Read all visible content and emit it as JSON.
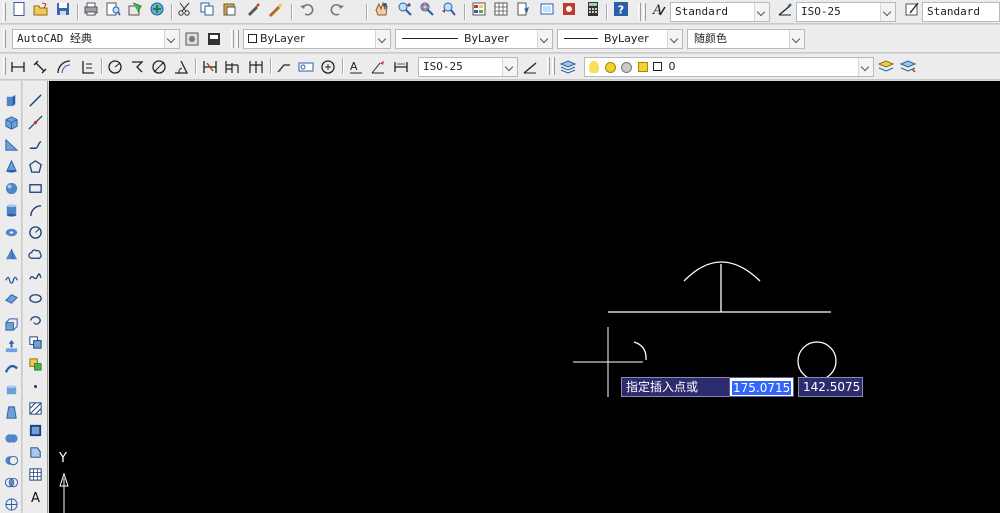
{
  "toolbar_top": {
    "text_style": "Standard",
    "dim_style": "ISO-25",
    "table_style": "Standard"
  },
  "toolbar_mid": {
    "workspace": "AutoCAD 经典",
    "layer_color": "ByLayer",
    "linetype": "ByLayer",
    "lineweight": "ByLayer",
    "plot_style": "随颜色"
  },
  "toolbar_dim": {
    "dim_style": "ISO-25",
    "layer_state": "0"
  },
  "canvas": {
    "background": "#000000",
    "y_axis_label": "Y"
  },
  "dynamic_input": {
    "prompt": "指定插入点或",
    "x_value": "175.0715",
    "y_value": "142.5075"
  },
  "icons": [
    "new-icon",
    "open-icon",
    "save-icon",
    "print-icon",
    "preview-icon",
    "publish-icon",
    "plot-icon",
    "cut-icon",
    "copy-icon",
    "paste-icon",
    "match-icon",
    "block-editor-icon",
    "undo-icon",
    "redo-icon",
    "pan-icon",
    "zoom-realtime-icon",
    "zoom-window-icon",
    "zoom-previous-icon",
    "properties-icon",
    "design-center-icon",
    "tool-palette-icon",
    "sheet-set-icon",
    "markup-icon",
    "calculator-icon",
    "help-icon",
    "text-style-icon",
    "dim-style-icon",
    "table-style-icon"
  ],
  "colors": {
    "accent": "#3366ff",
    "prompt_bg": "#2c2c6e",
    "toolbar": "#ececec"
  }
}
